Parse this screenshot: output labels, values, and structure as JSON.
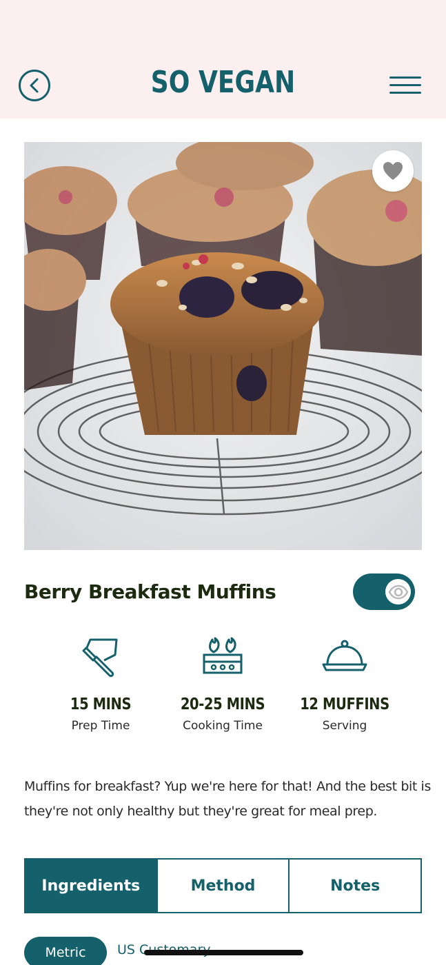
{
  "header": {
    "brand": "SO VEGAN",
    "back_icon": "chevron-left-circle-icon",
    "menu_icon": "hamburger-menu-icon"
  },
  "hero": {
    "image": "blueberry muffin on wire cooling rack",
    "favorite_icon": "heart-icon"
  },
  "recipe": {
    "title": "Berry Breakfast Muffins",
    "toggle_icon": "eye-icon",
    "toggle_on": true,
    "stats": [
      {
        "icon": "knife-board-icon",
        "value": "15 MINS",
        "label": "Prep Time"
      },
      {
        "icon": "stove-icon",
        "value": "20-25 MINS",
        "label": "Cooking Time"
      },
      {
        "icon": "cloche-icon",
        "value": "12 MUFFINS",
        "label": "Serving"
      }
    ],
    "description": "Muffins for breakfast? Yup we're here for that! And the best bit is they're not only healthy but they're great for meal prep."
  },
  "tabs": [
    {
      "label": "Ingredients",
      "active": true
    },
    {
      "label": "Method",
      "active": false
    },
    {
      "label": "Notes",
      "active": false
    }
  ],
  "units": {
    "active": "Metric",
    "other": "US Customary"
  },
  "colors": {
    "brand": "#14606b",
    "header_bg": "#fbf0ef",
    "text": "#1c2a10"
  }
}
